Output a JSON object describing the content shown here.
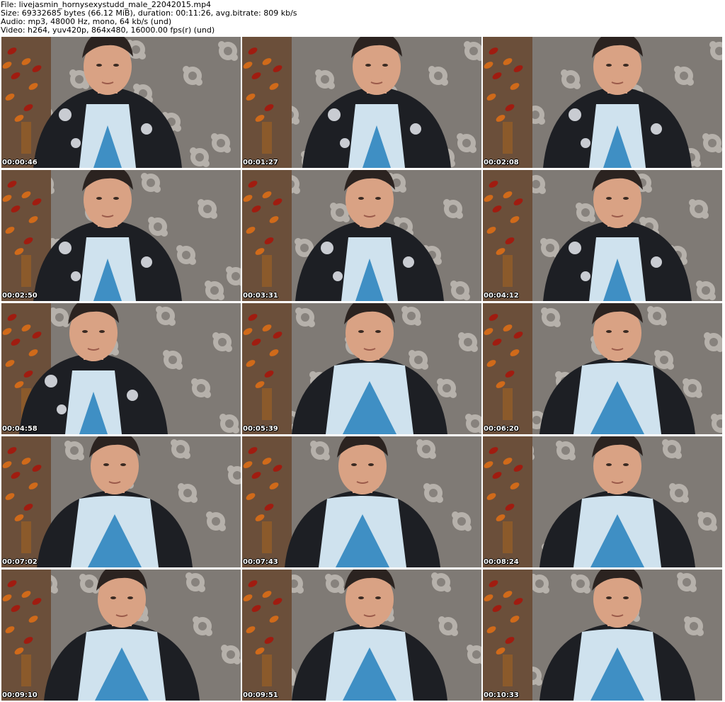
{
  "header": {
    "file_line": "File: livejasmin_hornysexystudd_male_22042015.mp4",
    "size_line": "Size: 69332685 bytes (66.12 MiB), duration: 00:11:26, avg.bitrate: 809 kb/s",
    "audio_line": "Audio: mp3, 48000 Hz, mono, 64 kb/s (und)",
    "video_line": "Video: h264, yuv420p, 864x480, 16000.00 fps(r) (und)"
  },
  "colors": {
    "background": "#ffffff",
    "curtain": "#8a8580",
    "curtain_dark": "#5e5a55",
    "flower": "#c9c4bd",
    "wall": "#6b4f3a",
    "plant_red": "#a01c10",
    "plant_orange": "#d06a1a",
    "skin": "#d9a284",
    "hair": "#2b2320",
    "jacket": "#1d1f24",
    "tee_light": "#cfe2ee",
    "tee_blue": "#3f8fc4"
  },
  "thumbnails": [
    {
      "timestamp": "00:00:46",
      "outfit": "jacket"
    },
    {
      "timestamp": "00:01:27",
      "outfit": "jacket"
    },
    {
      "timestamp": "00:02:08",
      "outfit": "jacket"
    },
    {
      "timestamp": "00:02:50",
      "outfit": "jacket"
    },
    {
      "timestamp": "00:03:31",
      "outfit": "jacket"
    },
    {
      "timestamp": "00:04:12",
      "outfit": "jacket"
    },
    {
      "timestamp": "00:04:58",
      "outfit": "jacket"
    },
    {
      "timestamp": "00:05:39",
      "outfit": "tee"
    },
    {
      "timestamp": "00:06:20",
      "outfit": "tee"
    },
    {
      "timestamp": "00:07:02",
      "outfit": "tee"
    },
    {
      "timestamp": "00:07:43",
      "outfit": "tee"
    },
    {
      "timestamp": "00:08:24",
      "outfit": "tee"
    },
    {
      "timestamp": "00:09:10",
      "outfit": "tee"
    },
    {
      "timestamp": "00:09:51",
      "outfit": "tee"
    },
    {
      "timestamp": "00:10:33",
      "outfit": "tee"
    }
  ]
}
